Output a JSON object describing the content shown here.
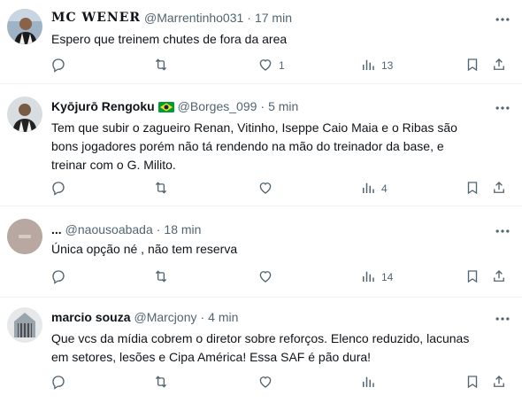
{
  "tweets": [
    {
      "name": "MC WENER",
      "handle": "@Marrentinho031",
      "sep": "·",
      "time": "17 min",
      "text_lines": [
        "Espero que treinem chutes de fora da area"
      ],
      "replies": "",
      "retweets": "",
      "likes": "1",
      "views": "13"
    },
    {
      "name": "Kyōjurō Rengoku",
      "handle": "@Borges_099",
      "sep": "·",
      "time": "5 min",
      "text_lines": [
        "Tem que subir o zagueiro Renan, Vitinho, Iseppe Caio Maia  e o Ribas são",
        "bons jogadores porém não tá rendendo na mão do treinador da base,  e",
        "treinar com o G. Milito."
      ],
      "replies": "",
      "retweets": "",
      "likes": "",
      "views": "4"
    },
    {
      "name": "...",
      "handle": "@naousoabada",
      "sep": "·",
      "time": "18 min",
      "text_lines": [
        "Única opção né , não tem reserva"
      ],
      "replies": "",
      "retweets": "",
      "likes": "",
      "views": "14"
    },
    {
      "name": "marcio souza",
      "handle": "@Marcjony",
      "sep": "·",
      "time": "4 min",
      "text_lines": [
        "Que vcs da mídia cobrem o diretor sobre reforços. Elenco reduzido, lacunas",
        "em setores, lesões e Cipa América! Essa SAF é pão dura!"
      ],
      "replies": "",
      "retweets": "",
      "likes": "",
      "views": ""
    }
  ],
  "colors": {
    "text": "#0f1419",
    "muted": "#536471",
    "border": "#eff3f4",
    "flag_green": "#009c3b",
    "flag_yellow": "#ffdf00",
    "flag_blue": "#002776"
  },
  "icons": [
    "more-icon",
    "reply-icon",
    "retweet-icon",
    "like-icon",
    "views-icon",
    "bookmark-icon",
    "share-icon",
    "brazil-flag-icon"
  ]
}
